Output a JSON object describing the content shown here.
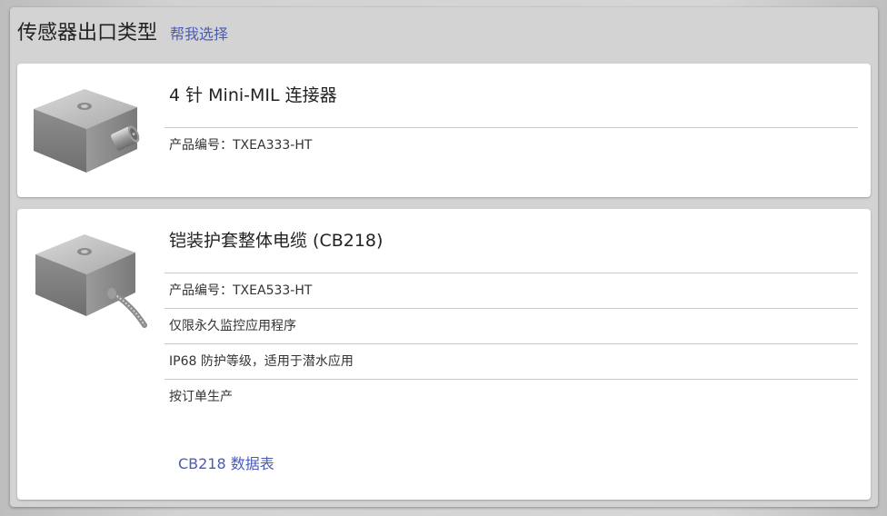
{
  "header": {
    "title": "传感器出口类型",
    "help_link": "帮我选择"
  },
  "products": [
    {
      "title": "4 针 Mini-MIL 连接器",
      "rows": [
        "产品编号：TXEA333-HT"
      ]
    },
    {
      "title": "铠装护套整体电缆 (CB218)",
      "rows": [
        "产品编号：TXEA533-HT",
        "仅限永久监控应用程序",
        "IP68 防护等级，适用于潜水应用",
        "按订单生产"
      ],
      "datasheet_link": "CB218 数据表"
    }
  ],
  "colors": {
    "link": "#4b5bb5",
    "panel": "#d3d3d3",
    "card": "#ffffff"
  }
}
